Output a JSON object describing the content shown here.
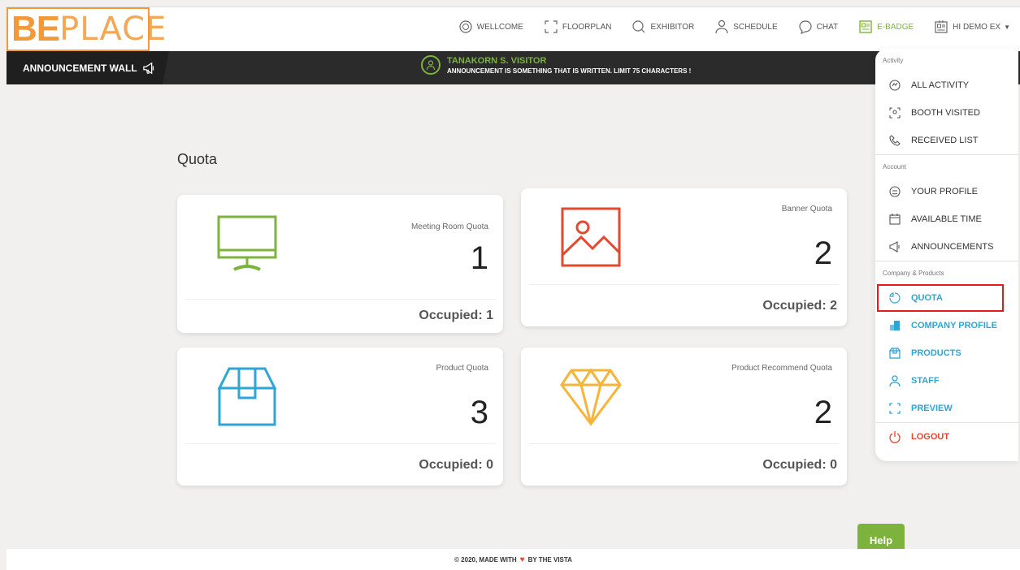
{
  "logo": {
    "part1": "BE",
    "part2": "PLACE"
  },
  "nav": [
    {
      "label": "WELLCOME",
      "icon": "globe-icon"
    },
    {
      "label": "FLOORPLAN",
      "icon": "floorplan-icon"
    },
    {
      "label": "EXHIBITOR",
      "icon": "search-icon"
    },
    {
      "label": "SCHEDULE",
      "icon": "schedule-icon"
    },
    {
      "label": "CHAT",
      "icon": "chat-icon"
    },
    {
      "label": "E-BADGE",
      "icon": "badge-icon"
    },
    {
      "label": "HI DEMO EX",
      "icon": "user-card-icon"
    }
  ],
  "announcement": {
    "wall_label": "ANNOUNCEMENT WALL",
    "name": "TANAKORN S. VISITOR",
    "text": "ANNOUNCEMENT IS SOMETHING THAT IS WRITTEN. LIMIT 75 CHARACTERS !"
  },
  "main": {
    "title": "Quota",
    "cards": [
      {
        "label": "Meeting Room Quota",
        "value": "1",
        "occupied": "Occupied: 1",
        "icon": "monitor-icon",
        "color": "#7db33c"
      },
      {
        "label": "Banner Quota",
        "value": "2",
        "occupied": "Occupied: 2",
        "icon": "image-icon",
        "color": "#e2492f"
      },
      {
        "label": "Product Quota",
        "value": "3",
        "occupied": "Occupied: 0",
        "icon": "box-icon",
        "color": "#2da6d6"
      },
      {
        "label": "Product Recommend Quota",
        "value": "2",
        "occupied": "Occupied: 0",
        "icon": "diamond-icon",
        "color": "#f5b53a"
      }
    ]
  },
  "menu": {
    "sections": [
      {
        "title": "Activity",
        "items": [
          {
            "label": "ALL ACTIVITY",
            "icon": "activity-icon"
          },
          {
            "label": "BOOTH VISITED",
            "icon": "booth-icon"
          },
          {
            "label": "RECEIVED LIST",
            "icon": "phone-icon"
          }
        ]
      },
      {
        "title": "Account",
        "items": [
          {
            "label": "YOUR PROFILE",
            "icon": "profile-icon"
          },
          {
            "label": "AVAILABLE TIME",
            "icon": "calendar-icon"
          },
          {
            "label": "ANNOUNCEMENTS",
            "icon": "megaphone-icon"
          }
        ]
      },
      {
        "title": "Company & Products",
        "items": [
          {
            "label": "QUOTA",
            "icon": "pie-icon"
          },
          {
            "label": "COMPANY PROFILE",
            "icon": "building-icon"
          },
          {
            "label": "PRODUCTS",
            "icon": "product-box-icon"
          },
          {
            "label": "STAFF",
            "icon": "staff-icon"
          },
          {
            "label": "PREVIEW",
            "icon": "preview-icon"
          },
          {
            "label": "LOGOUT",
            "icon": "power-icon"
          }
        ]
      }
    ]
  },
  "footer": {
    "text1": "© 2020, MADE WITH",
    "text2": "BY THE VISTA"
  },
  "help": {
    "label": "Help"
  },
  "colors": {
    "green": "#7db33c",
    "blue": "#2da6d6",
    "red": "#e2492f",
    "orange": "#f29a3a",
    "yellow": "#f5b53a"
  }
}
